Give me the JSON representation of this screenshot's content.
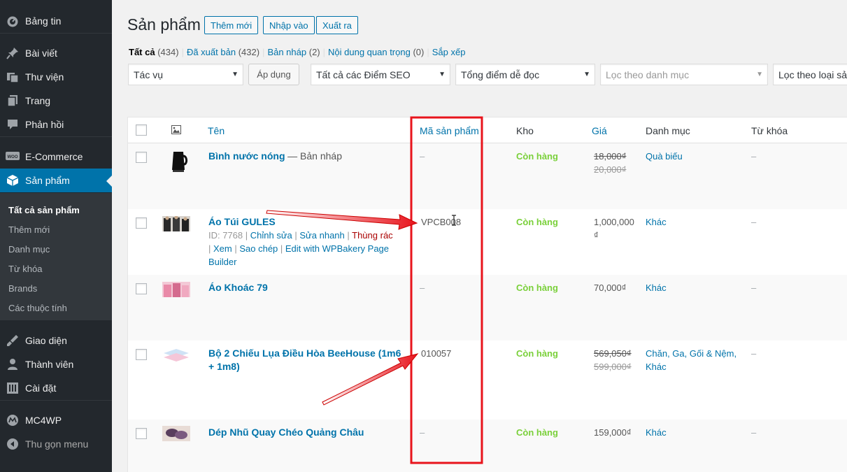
{
  "sidebar": {
    "items": [
      {
        "label": "Bảng tin",
        "icon": "dashboard-icon"
      },
      {
        "label": "Bài viết",
        "icon": "pin-icon"
      },
      {
        "label": "Thư viện",
        "icon": "media-icon"
      },
      {
        "label": "Trang",
        "icon": "pages-icon"
      },
      {
        "label": "Phản hồi",
        "icon": "comments-icon"
      },
      {
        "label": "E-Commerce",
        "icon": "woo-icon"
      },
      {
        "label": "Sản phẩm",
        "icon": "products-icon"
      },
      {
        "label": "Giao diện",
        "icon": "appearance-icon"
      },
      {
        "label": "Thành viên",
        "icon": "users-icon"
      },
      {
        "label": "Cài đặt",
        "icon": "settings-icon"
      },
      {
        "label": "MC4WP",
        "icon": "mc4wp-icon"
      },
      {
        "label": "Thu gọn menu",
        "icon": "collapse-icon"
      }
    ],
    "submenu": [
      "Tất cả sản phẩm",
      "Thêm mới",
      "Danh mục",
      "Từ khóa",
      "Brands",
      "Các thuộc tính"
    ]
  },
  "header": {
    "title": "Sản phẩm",
    "buttons": [
      "Thêm mới",
      "Nhập vào",
      "Xuất ra"
    ]
  },
  "filters": {
    "views": [
      {
        "label": "Tất cả",
        "count": "(434)"
      },
      {
        "label": "Đã xuất bản",
        "count": "(432)"
      },
      {
        "label": "Bản nháp",
        "count": "(2)"
      },
      {
        "label": "Nội dung quan trọng",
        "count": "(0)"
      },
      {
        "label": "Sắp xếp",
        "count": ""
      }
    ],
    "bulk_action": "Tác vụ",
    "apply": "Áp dụng",
    "seo": "Tất cả các Điểm SEO",
    "readability": "Tổng điểm dễ đọc",
    "category_placeholder": "Lọc theo danh mục",
    "type": "Lọc theo loại sản"
  },
  "table": {
    "columns": [
      "Tên",
      "Mã sản phẩm",
      "Kho",
      "Giá",
      "Danh mục",
      "Từ khóa"
    ],
    "rows": [
      {
        "name": "Bình nước nóng",
        "state": "— Bản nháp",
        "sku": "–",
        "stock": "Còn hàng",
        "price": "18,000₫",
        "old_price": "20,000₫",
        "category": "Quà biếu",
        "tags": "–"
      },
      {
        "name": "Áo Túi GULES",
        "id": "ID: 7768 |",
        "actions": [
          "Chỉnh sửa",
          "Sửa nhanh",
          "Thùng rác",
          "Xem",
          "Sao chép",
          "Edit with WPBakery Page Builder"
        ],
        "sku": "VPCB008",
        "stock": "Còn hàng",
        "price": "1,000,000 ₫",
        "category": "Khác",
        "tags": "–"
      },
      {
        "name": "Áo Khoác 79",
        "sku": "–",
        "stock": "Còn hàng",
        "price": "70,000₫",
        "category": "Khác",
        "tags": "–"
      },
      {
        "name": "Bộ 2 Chiếu Lụa Điều Hòa BeeHouse (1m6 + 1m8)",
        "sku": "010057",
        "stock": "Còn hàng",
        "price": "569,050₫",
        "old_price": "599,000₫",
        "category": "Chăn, Ga, Gối & Nệm, Khác",
        "tags": "–"
      },
      {
        "name": "Dép Nhũ Quay Chéo Quảng Châu",
        "sku": "–",
        "stock": "Còn hàng",
        "price": "159,000₫",
        "category": "Khác",
        "tags": "–"
      }
    ]
  },
  "colors": {
    "sidebar_bg": "#23282d",
    "accent": "#0073aa",
    "in_stock": "#7ad03a",
    "annotation": "#e8141c"
  }
}
